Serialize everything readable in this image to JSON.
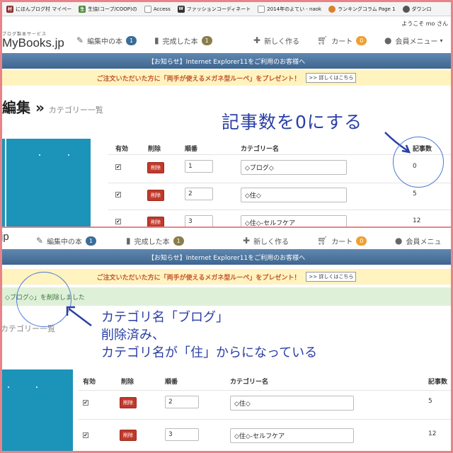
{
  "bookmarks": [
    {
      "label": "にほんブログ村 マイペー",
      "icon": "blog-mura-icon",
      "color": "#8e2b2b",
      "glyph": "村"
    },
    {
      "label": "生協(コープ/COOP)の",
      "icon": "coop-icon",
      "color": "#4f8a3a",
      "glyph": "生"
    },
    {
      "label": "Access",
      "icon": "document-icon",
      "color": "#7a7a7a",
      "glyph": "□"
    },
    {
      "label": "ファッションコーディネート",
      "icon": "wear-icon",
      "color": "#333333",
      "glyph": "W"
    },
    {
      "label": "2014年のよてい - naok",
      "icon": "document-icon",
      "color": "#7a7a7a",
      "glyph": "□"
    },
    {
      "label": "ランキングコラム Page 1",
      "icon": "ranking-icon",
      "color": "#d9822b",
      "glyph": "●"
    },
    {
      "label": "ダウンロ",
      "icon": "download-icon",
      "color": "#555555",
      "glyph": "◎"
    }
  ],
  "welcome": "ようこそ mo さん",
  "logo": {
    "sub": "ブログ製本サービス",
    "title": "MyBooks.jp",
    "title_short": "jp"
  },
  "nav": {
    "editing": "編集中の本",
    "editing_count": "1",
    "finished": "完成した本",
    "finished_count": "1",
    "new": "新しく作る",
    "cart": "カート",
    "cart_count": "0",
    "member": "会員メニュー",
    "member_short": "会員メニュ"
  },
  "notice": "【お知らせ】Internet Explorer11をご利用のお客様へ",
  "promo": {
    "text": "ご注文いただいた方に「両手が使えるメガネ型ルーペ」をプレゼント！",
    "link": ">> 詳しくはこちら"
  },
  "title_main": "編集",
  "title_arrow": "»",
  "title_sub": "カテゴリー一覧",
  "title_sub_cut": "カテゴリー一覧",
  "table": {
    "headers": {
      "active": "有効",
      "delete": "削除",
      "order": "順番",
      "name": "カテゴリー名",
      "count": "記事数"
    }
  },
  "top_rows": [
    {
      "check": "✔",
      "delete": "削除",
      "order": "1",
      "name": "◇ブログ◇",
      "count": "0"
    },
    {
      "check": "✔",
      "delete": "削除",
      "order": "2",
      "name": "◇住◇",
      "count": "5"
    },
    {
      "check": "✔",
      "delete": "削除",
      "order": "3",
      "name": "◇住◇-セルフケア",
      "count": "12"
    }
  ],
  "bottom_rows": [
    {
      "check": "✔",
      "delete": "削除",
      "order": "2",
      "name": "◇住◇",
      "count": "5"
    },
    {
      "check": "✔",
      "delete": "削除",
      "order": "3",
      "name": "◇住◇-セルフケア",
      "count": "12"
    }
  ],
  "success_msg": "◇ブログ◇」を削除しました",
  "annotations": {
    "top": "記事数を0にする",
    "bottom_line1": "カテゴリ名「ブログ」",
    "bottom_line2": "削除済み、",
    "bottom_line3": "カテゴリ名が「住」からになっている"
  },
  "colors": {
    "border": "#e8838a",
    "annotation": "#2a3fa5",
    "thumb": "#1c93b8",
    "delete": "#c0392b"
  }
}
